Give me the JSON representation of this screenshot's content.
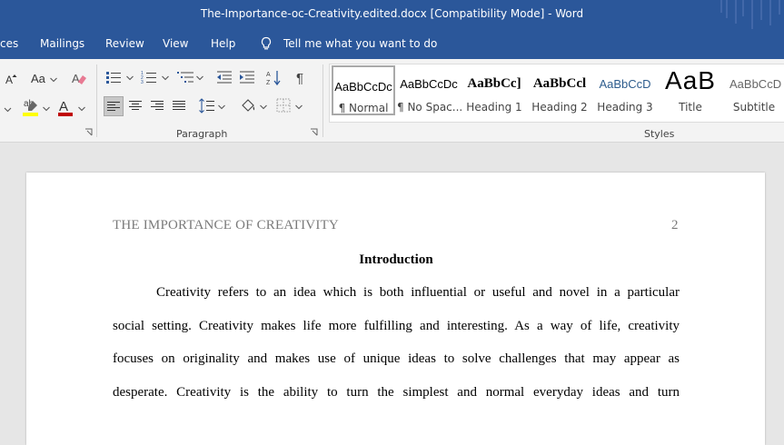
{
  "window": {
    "title": "The-Importance-oc-Creativity.edited.docx [Compatibility Mode]  -  Word"
  },
  "tabs": [
    {
      "label": "ces"
    },
    {
      "label": "Mailings"
    },
    {
      "label": "Review"
    },
    {
      "label": "View"
    },
    {
      "label": "Help"
    }
  ],
  "tell_me": {
    "label": "Tell me what you want to do"
  },
  "ribbon": {
    "font_group": {
      "change_case_label": "Aa"
    },
    "paragraph_group": {
      "label": "Paragraph"
    },
    "styles_group": {
      "label": "Styles",
      "items": [
        {
          "sample": "AaBbCcDc",
          "name": "¶ Normal",
          "selected": true
        },
        {
          "sample": "AaBbCcDc",
          "name": "¶ No Spac..."
        },
        {
          "sample": "AaBbCc]",
          "name": "Heading 1"
        },
        {
          "sample": "AaBbCcl",
          "name": "Heading 2"
        },
        {
          "sample": "AaBbCcD",
          "name": "Heading 3"
        },
        {
          "sample": "AaB",
          "name": "Title"
        },
        {
          "sample": "AaBbCcD",
          "name": "Subtitle"
        }
      ]
    },
    "colors": {
      "highlight": "#ffff00",
      "font_color": "#c00000"
    }
  },
  "document": {
    "header_title": "THE IMPORTANCE OF CREATIVITY",
    "page_number": "2",
    "heading": "Introduction",
    "lines": [
      "Creativity refers to an idea which is both influential or useful and novel in a particular",
      "social setting. Creativity makes life more fulfilling and interesting. As a way of life, creativity",
      "focuses on originality and makes use of unique ideas to solve challenges that may appear as",
      "desperate. Creativity is the ability to turn the simplest and normal everyday ideas and turn"
    ]
  },
  "theme": {
    "accent": "#2b579a"
  }
}
